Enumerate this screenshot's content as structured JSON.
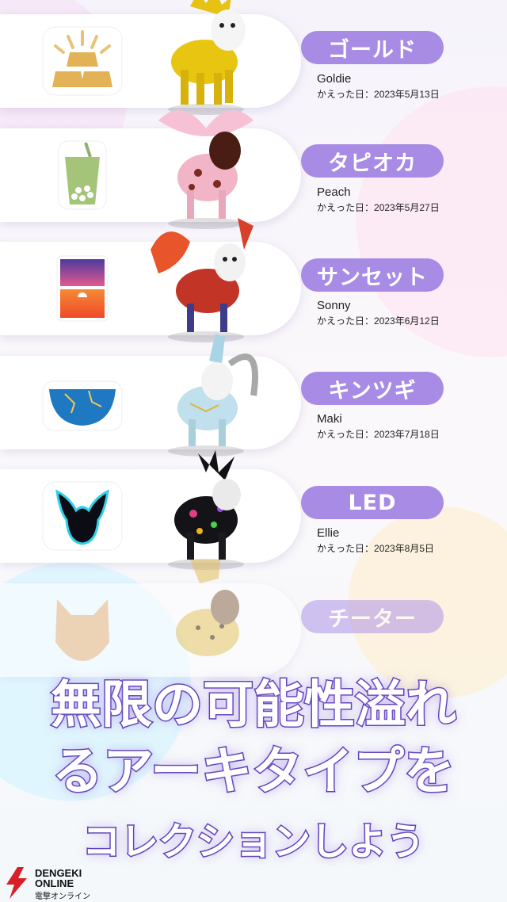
{
  "collection": [
    {
      "archetype": "ゴールド",
      "pet_name": "Goldie",
      "hatch_label": "かえった日：",
      "hatch_date": "2023年5月13日",
      "emblem_icon": "gold-bars-icon"
    },
    {
      "archetype": "タピオカ",
      "pet_name": "Peach",
      "hatch_label": "かえった日：",
      "hatch_date": "2023年5月27日",
      "emblem_icon": "bubble-tea-icon"
    },
    {
      "archetype": "サンセット",
      "pet_name": "Sonny",
      "hatch_label": "かえった日：",
      "hatch_date": "2023年6月12日",
      "emblem_icon": "sunset-icon"
    },
    {
      "archetype": "キンツギ",
      "pet_name": "Maki",
      "hatch_label": "かえった日：",
      "hatch_date": "2023年7月18日",
      "emblem_icon": "kintsugi-bowl-icon"
    },
    {
      "archetype": "LED",
      "pet_name": "Ellie",
      "hatch_label": "かえった日：",
      "hatch_date": "2023年8月5日",
      "emblem_icon": "led-silhouette-icon"
    },
    {
      "archetype": "チーター",
      "emblem_icon": "cheetah-face-icon"
    }
  ],
  "headline": {
    "line1": "無限の可能性溢れ",
    "line2": "るアーキタイプを",
    "line3": "コレクションしよう"
  },
  "watermark": {
    "brand": "DENGEKI",
    "brand2": "ONLINE",
    "sub": "電撃オンライン"
  },
  "colors": {
    "badge": "#a78be5",
    "headline_stroke": "#5a3fb6"
  }
}
